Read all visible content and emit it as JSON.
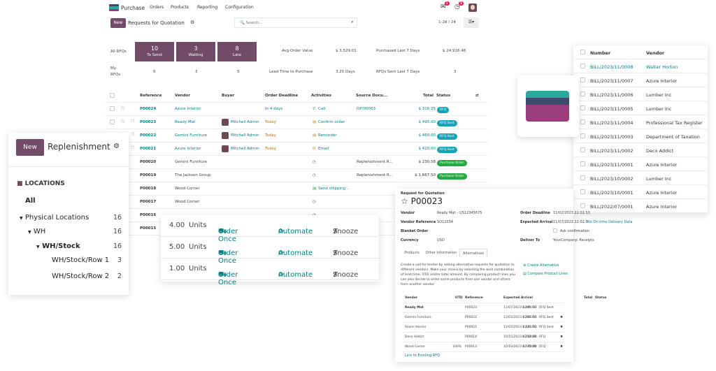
{
  "topbar": {
    "app_name": "Purchase",
    "menu": [
      "Orders",
      "Products",
      "Reporting",
      "Configuration"
    ],
    "messages_badge": "1",
    "activities_badge": "5",
    "logo_colors": [
      "#3d4b6f",
      "#2aa99a",
      "#8f3d74"
    ]
  },
  "control": {
    "new_label": "New",
    "title": "Requests for Quotation",
    "search_placeholder": "Search...",
    "pager": "1-24 / 24"
  },
  "kpi": {
    "all_rfqs_label": "All RFQs",
    "my_rfqs_label": "My RFQs",
    "boxes": [
      {
        "value": "10",
        "label": "To Send",
        "mine": "6"
      },
      {
        "value": "3",
        "label": "Waiting",
        "mine": "3"
      },
      {
        "value": "8",
        "label": "Late",
        "mine": "5"
      }
    ],
    "avg_order_value_label": "Avg Order Value",
    "avg_order_value": "$ 3,529.01",
    "purchased_7d_label": "Purchased Last 7 Days",
    "purchased_7d": "$ 24,916.48",
    "lead_time_label": "Lead Time to Purchase",
    "lead_time": "3.25 Days",
    "rfqs_sent_label": "RFQs Sent Last 7 Days",
    "rfqs_sent": "3"
  },
  "list": {
    "headers": [
      "Reference",
      "Vendor",
      "Buyer",
      "Order Deadline",
      "Activities",
      "Source Docu...",
      "Total",
      "Status"
    ],
    "rows": [
      {
        "ref": "P00024",
        "vendor": "Azure Interior",
        "buyer": "",
        "deadline": "In 4 days",
        "activity": "Call",
        "source": "OP/00003",
        "total": "$ 316.25",
        "status": "RFQ"
      },
      {
        "ref": "P00023",
        "vendor": "Ready Mat",
        "buyer": "Mitchell Admin",
        "deadline": "Today",
        "activity": "Confirm order",
        "source": "",
        "total": "$ 495.00",
        "status": "RFQ Sent"
      },
      {
        "ref": "P00022",
        "vendor": "Gemini Furniture",
        "buyer": "Mitchell Admin",
        "deadline": "Today",
        "activity": "Reminder",
        "source": "",
        "total": "$ 460.00",
        "status": "RFQ Sent"
      },
      {
        "ref": "P00021",
        "vendor": "Azure Interior",
        "buyer": "Mitchell Admin",
        "deadline": "Today",
        "activity": "Email",
        "source": "",
        "total": "$ 420.00",
        "status": "RFQ Sent"
      },
      {
        "ref": "P00020",
        "vendor": "Gemini Furniture",
        "buyer": "",
        "deadline": "",
        "activity": "",
        "source": "Replenishment R...",
        "total": "$ 230.58",
        "status": "Purchase Order"
      },
      {
        "ref": "P00019",
        "vendor": "The Jackson Group",
        "buyer": "",
        "deadline": "",
        "activity": "",
        "source": "Replenishment R...",
        "total": "$ 1,667.50",
        "status": "Purchase Order"
      },
      {
        "ref": "P00018",
        "vendor": "Wood Corner",
        "buyer": "",
        "deadline": "",
        "activity": "Send shipping...",
        "source": "",
        "total": "",
        "status": ""
      },
      {
        "ref": "P00017",
        "vendor": "Wood Corner",
        "buyer": "",
        "deadline": "",
        "activity": "",
        "source": "",
        "total": "",
        "status": ""
      },
      {
        "ref": "P00016",
        "vendor": "",
        "buyer": "",
        "deadline": "",
        "activity": "",
        "source": "",
        "total": "",
        "status": ""
      },
      {
        "ref": "P00015",
        "vendor": "",
        "buyer": "",
        "deadline": "",
        "activity": "",
        "source": "",
        "total": "",
        "status": ""
      }
    ]
  },
  "replenishment": {
    "new_label": "New",
    "title": "Replenishment",
    "locations_header": "LOCATIONS",
    "all_label": "All",
    "tree": [
      {
        "label": "Physical Locations",
        "count": "16"
      },
      {
        "label": "WH",
        "count": "16"
      },
      {
        "label": "WH/Stock",
        "count": "16"
      },
      {
        "label": "WH/Stock/Row 1",
        "count": "3"
      },
      {
        "label": "WH/Stock/Row 2",
        "count": "2"
      }
    ]
  },
  "actions": {
    "rows": [
      {
        "qty": "4.00",
        "uom": "Units"
      },
      {
        "qty": "5.00",
        "uom": "Units"
      },
      {
        "qty": "1.00",
        "uom": "Units"
      }
    ],
    "order_once": "Order Once",
    "automate": "Automate",
    "snooze": "Snooze"
  },
  "bills": {
    "headers": [
      "Number",
      "Vendor"
    ],
    "rows": [
      {
        "number": "BILL/2023/11/0008",
        "vendor": "Walter Horton"
      },
      {
        "number": "BILL/2023/11/0007",
        "vendor": "Azure Interior"
      },
      {
        "number": "BILL/2023/11/0006",
        "vendor": "Lumber Inc"
      },
      {
        "number": "BILL/2023/11/0005",
        "vendor": "Lumber Inc"
      },
      {
        "number": "BILL/2023/11/0004",
        "vendor": "Professional Tax Register"
      },
      {
        "number": "BILL/2023/11/0003",
        "vendor": "Department of Taxation"
      },
      {
        "number": "BILL/2023/11/0002",
        "vendor": "Deco Addict"
      },
      {
        "number": "BILL/2023/11/0001",
        "vendor": "Azure Interior"
      },
      {
        "number": "BILL/2023/10/0002",
        "vendor": "Lumber Inc"
      },
      {
        "number": "BILL/2023/10/0001",
        "vendor": "Azure Interior"
      },
      {
        "number": "BILL/2022/07/0001",
        "vendor": "Azure Interior"
      }
    ]
  },
  "rfq_form": {
    "subtitle": "Request for Quotation",
    "reference": "P00023",
    "vendor_label": "Vendor",
    "vendor_value": "Ready Mat – US12345675",
    "vendor_ref_label": "Vendor Reference",
    "vendor_ref_value": "SO12034",
    "blanket_label": "Blanket Order",
    "currency_label": "Currency",
    "currency_value": "USD",
    "deadline_label": "Order Deadline",
    "deadline_value": "11/02/2023 22:01:53",
    "arrival_label": "Expected Arrival",
    "arrival_value": "11/07/2023 22:01:5",
    "no_ontime": "No On-time Delivery Data",
    "ask_confirmation": "Ask confirmation",
    "deliver_label": "Deliver To",
    "deliver_value": "YourCompany: Receipts",
    "tabs": [
      "Products",
      "Other Information",
      "Alternatives"
    ],
    "help_text": "Create a call for tender by adding alternative requests for quotation to different vendors. Make your choice by selecting the best combination of lead time, OTD and/or total amount. By comparing product lines you can also decide to order some products from one vendor and others from another vendor.",
    "create_alt": "Create Alternative",
    "compare": "Compare Product Lines",
    "alt_headers": [
      "Vendor",
      "OTD",
      "Reference",
      "Expected Arrival",
      "Total",
      "Status"
    ],
    "alt_rows": [
      {
        "vendor": "Ready Mat",
        "otd": "",
        "ref": "P00023",
        "arrival": "11/07/2023 22:01:53",
        "total": "$ 495.00",
        "status": "RFQ Sent"
      },
      {
        "vendor": "Gemini Furniture",
        "otd": "",
        "ref": "P00022",
        "arrival": "11/02/2023 22:01:53",
        "total": "$ 460.00",
        "status": "RFQ Sent"
      },
      {
        "vendor": "Azure Interior",
        "otd": "",
        "ref": "P00021",
        "arrival": "11/02/2023 22:01:53",
        "total": "$ 420.00",
        "status": "RFQ Sent"
      },
      {
        "vendor": "Deco Addict",
        "otd": "",
        "ref": "P00014",
        "arrival": "10/15/2023 02:00:00",
        "total": "$ 552.00",
        "status": "RFQ"
      },
      {
        "vendor": "Wood Corner",
        "otd": "100%",
        "ref": "P00013",
        "arrival": "10/10/2023 02:00:00",
        "total": "$ 575.00",
        "status": "RFQ"
      }
    ],
    "link_existing": "Link to Existing RFQ"
  },
  "colors": {
    "brand": "#714b67",
    "link": "#017e84",
    "status_blue": "#17a2b8",
    "status_green": "#28a745"
  }
}
